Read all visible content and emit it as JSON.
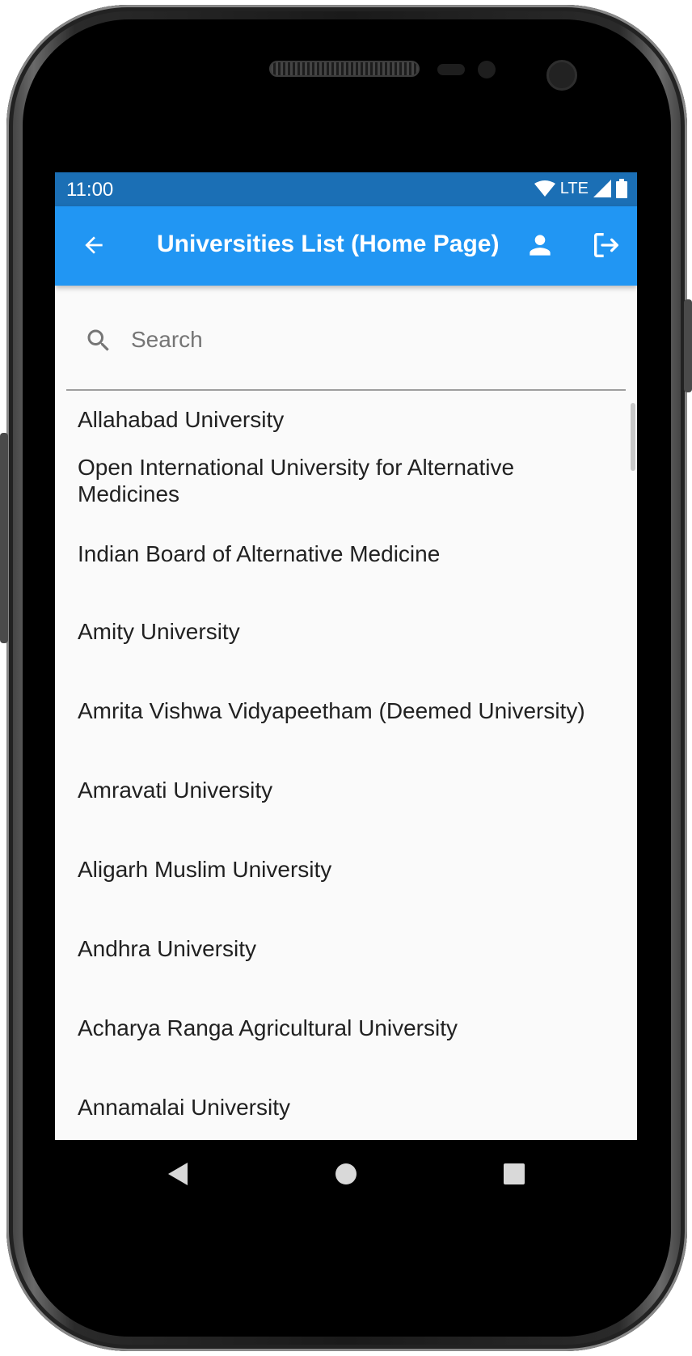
{
  "status_bar": {
    "time": "11:00",
    "network": "LTE"
  },
  "app_bar": {
    "title": "Universities List (Home Page)",
    "color": "#2196f3",
    "status_color": "#1b6fb5"
  },
  "search": {
    "placeholder": "Search",
    "value": ""
  },
  "universities": [
    "Allahabad University",
    "Open International University for Alternative Medicines",
    "Indian Board of Alternative Medicine",
    "Amity University",
    "Amrita Vishwa Vidyapeetham (Deemed University)",
    "Amravati University",
    "Aligarh Muslim University",
    "Andhra University",
    "Acharya Ranga Agricultural University",
    "Annamalai University"
  ]
}
